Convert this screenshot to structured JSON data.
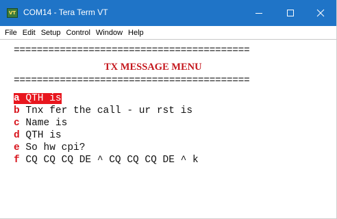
{
  "window": {
    "title": "COM14 - Tera Term VT",
    "icon": "teraterm-app-icon",
    "icon_text": "VT"
  },
  "menubar": {
    "items": [
      "File",
      "Edit",
      "Setup",
      "Control",
      "Window",
      "Help"
    ]
  },
  "terminal": {
    "separator": "=========================================",
    "heading": "TX MESSAGE MENU",
    "options": [
      {
        "key": "a",
        "text": " QTH is",
        "selected": true
      },
      {
        "key": "b",
        "text": " Tnx fer the call - ur rst is",
        "selected": false
      },
      {
        "key": "c",
        "text": " Name is",
        "selected": false
      },
      {
        "key": "d",
        "text": " QTH is",
        "selected": false
      },
      {
        "key": "e",
        "text": " So hw cpi?",
        "selected": false
      },
      {
        "key": "f",
        "text": " CQ CQ CQ DE ^ CQ CQ CQ DE ^ k",
        "selected": false
      }
    ]
  },
  "colors": {
    "titlebar": "#1f74c7",
    "key_red": "#d8141c",
    "selection_red": "#e8161e"
  }
}
